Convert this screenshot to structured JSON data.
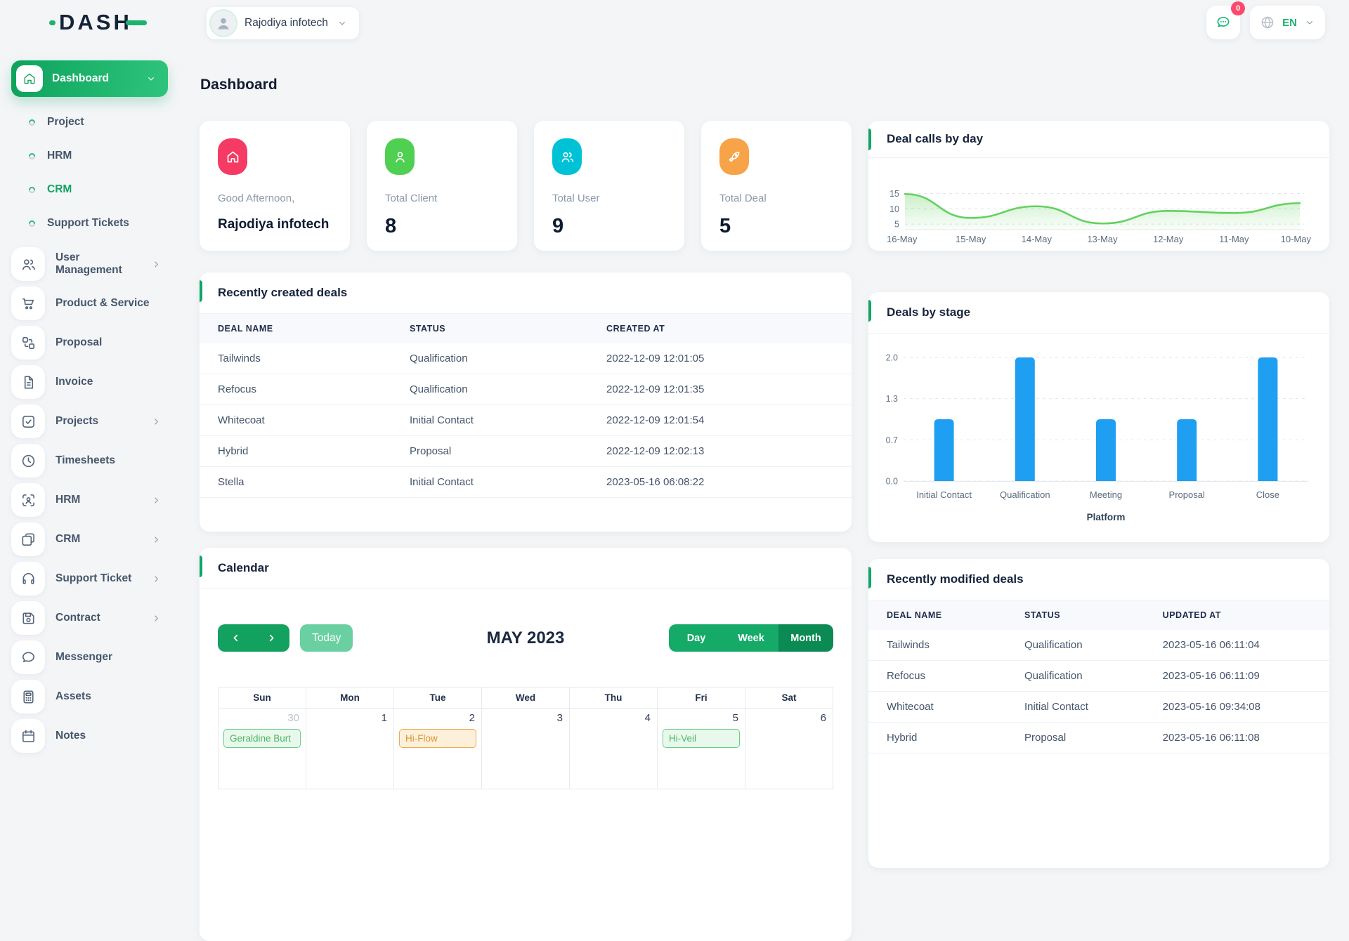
{
  "brand": {
    "logo_text": "DASH"
  },
  "topbar": {
    "workspace": {
      "name": "Rajodiya infotech",
      "avatar_icon": "person",
      "chevron_icon": "chevron-down"
    },
    "messages": {
      "icon": "message",
      "badge": "0"
    },
    "language": {
      "icon": "globe",
      "code": "EN",
      "chevron_icon": "chevron-down"
    }
  },
  "page": {
    "title": "Dashboard"
  },
  "sidebar": {
    "active_item": {
      "label": "Dashboard",
      "icon": "home",
      "chevron_icon": "chevron-down"
    },
    "sub_items": [
      {
        "label": "Project"
      },
      {
        "label": "HRM"
      },
      {
        "label": "CRM",
        "active": true
      },
      {
        "label": "Support Tickets"
      }
    ],
    "items": [
      {
        "label": "User Management",
        "icon": "users",
        "chevron_icon": "chevron-right"
      },
      {
        "label": "Product & Service",
        "icon": "cart"
      },
      {
        "label": "Proposal",
        "icon": "blocks"
      },
      {
        "label": "Invoice",
        "icon": "file"
      },
      {
        "label": "Projects",
        "icon": "check-square",
        "chevron_icon": "chevron-right"
      },
      {
        "label": "Timesheets",
        "icon": "clock"
      },
      {
        "label": "HRM",
        "icon": "user-focus",
        "chevron_icon": "chevron-right"
      },
      {
        "label": "CRM",
        "icon": "cards",
        "chevron_icon": "chevron-right"
      },
      {
        "label": "Support Ticket",
        "icon": "headset",
        "chevron_icon": "chevron-right"
      },
      {
        "label": "Contract",
        "icon": "save",
        "chevron_icon": "chevron-right"
      },
      {
        "label": "Messenger",
        "icon": "chat"
      },
      {
        "label": "Assets",
        "icon": "calculator"
      },
      {
        "label": "Notes",
        "icon": "calendar"
      }
    ]
  },
  "stats": [
    {
      "label": "Good Afternoon,",
      "value": "Rajodiya infotech",
      "icon": "home",
      "color": "#f53a63",
      "value_small": true
    },
    {
      "label": "Total Client",
      "value": "8",
      "icon": "user",
      "color": "#4fd053"
    },
    {
      "label": "Total User",
      "value": "9",
      "icon": "users",
      "color": "#00c2d6"
    },
    {
      "label": "Total Deal",
      "value": "5",
      "icon": "rocket",
      "color": "#f7a348"
    }
  ],
  "panels": {
    "deal_calls": {
      "title": "Deal calls by day"
    },
    "deals_by_stage": {
      "title": "Deals by stage"
    },
    "recent_created": {
      "title": "Recently created deals",
      "headers": [
        "DEAL NAME",
        "STATUS",
        "CREATED AT"
      ],
      "rows": [
        [
          "Tailwinds",
          "Qualification",
          "2022-12-09 12:01:05"
        ],
        [
          "Refocus",
          "Qualification",
          "2022-12-09 12:01:35"
        ],
        [
          "Whitecoat",
          "Initial Contact",
          "2022-12-09 12:01:54"
        ],
        [
          "Hybrid",
          "Proposal",
          "2022-12-09 12:02:13"
        ],
        [
          "Stella",
          "Initial Contact",
          "2023-05-16 06:08:22"
        ]
      ]
    },
    "recent_modified": {
      "title": "Recently modified deals",
      "headers": [
        "DEAL NAME",
        "STATUS",
        "UPDATED AT"
      ],
      "rows": [
        [
          "Tailwinds",
          "Qualification",
          "2023-05-16 06:11:04"
        ],
        [
          "Refocus",
          "Qualification",
          "2023-05-16 06:11:09"
        ],
        [
          "Whitecoat",
          "Initial Contact",
          "2023-05-16 09:34:08"
        ],
        [
          "Hybrid",
          "Proposal",
          "2023-05-16 06:11:08"
        ]
      ]
    }
  },
  "calendar": {
    "title": "Calendar",
    "nav": {
      "prev_icon": "chevron-left",
      "next_icon": "chevron-right"
    },
    "today_label": "Today",
    "month_label": "MAY 2023",
    "views": [
      {
        "label": "Day"
      },
      {
        "label": "Week"
      },
      {
        "label": "Month",
        "active": true
      }
    ],
    "day_headers": [
      "Sun",
      "Mon",
      "Tue",
      "Wed",
      "Thu",
      "Fri",
      "Sat"
    ],
    "week1": [
      {
        "num": "30",
        "muted": true,
        "event": {
          "label": "Geraldine Burt",
          "color": "green"
        }
      },
      {
        "num": "1"
      },
      {
        "num": "2",
        "event": {
          "label": "Hi-Flow",
          "color": "orange"
        }
      },
      {
        "num": "3"
      },
      {
        "num": "4"
      },
      {
        "num": "5",
        "event": {
          "label": "Hi-Veil",
          "color": "green"
        }
      },
      {
        "num": "6"
      }
    ]
  },
  "chart_data": [
    {
      "type": "area",
      "title": "Deal calls by day",
      "x": [
        "16-May",
        "15-May",
        "14-May",
        "13-May",
        "12-May",
        "11-May",
        "10-May"
      ],
      "series": [
        {
          "name": "Deal calls",
          "values": [
            14.8,
            7,
            10.8,
            5.2,
            9.3,
            8.6,
            11.8
          ]
        }
      ],
      "yticks": [
        5,
        10,
        15
      ],
      "ylim": [
        3.2,
        16
      ],
      "grid": "horizontal-dashed",
      "legend": false,
      "color": "#63d15f"
    },
    {
      "type": "bar",
      "title": "Deals by stage",
      "categories": [
        "Initial Contact",
        "Qualification",
        "Meeting",
        "Proposal",
        "Close"
      ],
      "values": [
        1,
        2,
        1,
        1,
        2
      ],
      "ytick_values": [
        0,
        0.6667,
        1.3333,
        2
      ],
      "ytick_labels": [
        "0.0",
        "0.7",
        "1.3",
        "2.0"
      ],
      "ylim": [
        0,
        2
      ],
      "xlabel": "Platform",
      "legend": false,
      "color": "#1e9ff2"
    }
  ]
}
